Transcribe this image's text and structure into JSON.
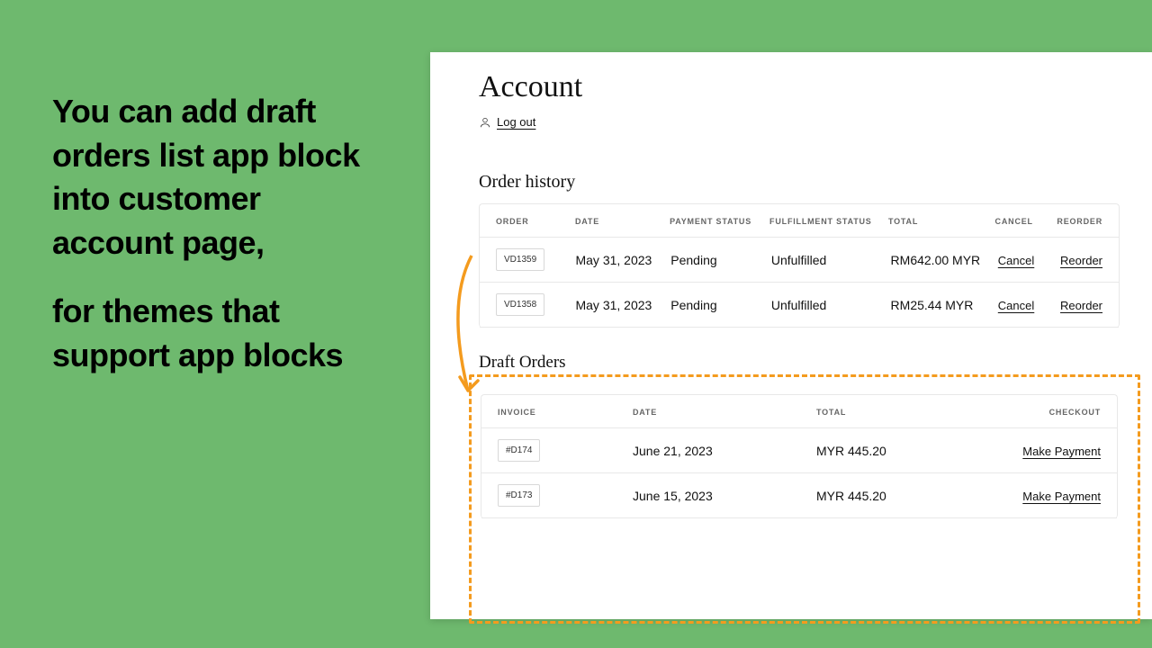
{
  "promo": {
    "para1": "You can add draft orders list app block into customer account page,",
    "para2": "for themes that support app blocks"
  },
  "account": {
    "title": "Account",
    "logout_label": "Log out"
  },
  "order_history": {
    "heading": "Order history",
    "headers": {
      "order": "ORDER",
      "date": "DATE",
      "payment": "PAYMENT STATUS",
      "fulfillment": "FULFILLMENT STATUS",
      "total": "TOTAL",
      "cancel": "CANCEL",
      "reorder": "REORDER"
    },
    "rows": [
      {
        "order": "VD1359",
        "date": "May 31, 2023",
        "payment": "Pending",
        "fulfillment": "Unfulfilled",
        "total": "RM642.00 MYR",
        "cancel": "Cancel",
        "reorder": "Reorder"
      },
      {
        "order": "VD1358",
        "date": "May 31, 2023",
        "payment": "Pending",
        "fulfillment": "Unfulfilled",
        "total": "RM25.44 MYR",
        "cancel": "Cancel",
        "reorder": "Reorder"
      }
    ]
  },
  "draft_orders": {
    "heading": "Draft Orders",
    "headers": {
      "invoice": "INVOICE",
      "date": "DATE",
      "total": "TOTAL",
      "checkout": "CHECKOUT"
    },
    "rows": [
      {
        "invoice": "#D174",
        "date": "June 21, 2023",
        "total": "MYR 445.20",
        "checkout": "Make Payment"
      },
      {
        "invoice": "#D173",
        "date": "June 15, 2023",
        "total": "MYR 445.20",
        "checkout": "Make Payment"
      }
    ]
  }
}
